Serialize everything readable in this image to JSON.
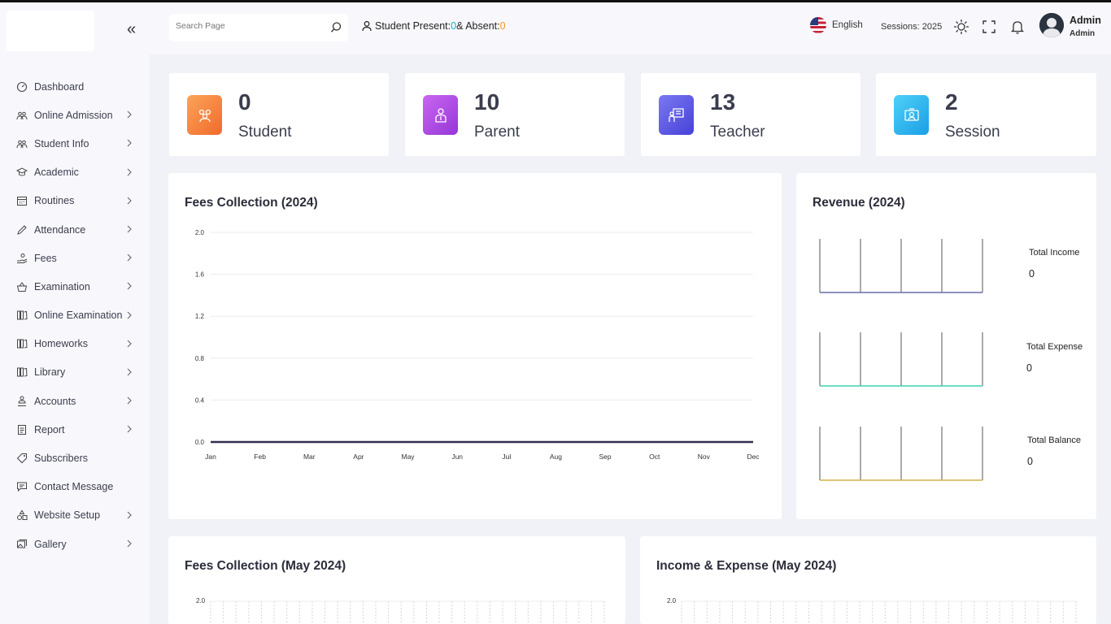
{
  "sidebar": {
    "items": [
      {
        "label": "Dashboard",
        "icon": "dashboard-icon",
        "chevron": false
      },
      {
        "label": "Online Admission",
        "icon": "users-icon",
        "chevron": true
      },
      {
        "label": "Student Info",
        "icon": "users-icon",
        "chevron": true
      },
      {
        "label": "Academic",
        "icon": "graduation-cap-icon",
        "chevron": true
      },
      {
        "label": "Routines",
        "icon": "calendar-icon",
        "chevron": true
      },
      {
        "label": "Attendance",
        "icon": "pen-icon",
        "chevron": true
      },
      {
        "label": "Fees",
        "icon": "hand-coin-icon",
        "chevron": true
      },
      {
        "label": "Examination",
        "icon": "basket-icon",
        "chevron": true
      },
      {
        "label": "Online Examination",
        "icon": "books-icon",
        "chevron": true
      },
      {
        "label": "Homeworks",
        "icon": "books-icon",
        "chevron": true
      },
      {
        "label": "Library",
        "icon": "books-icon",
        "chevron": true
      },
      {
        "label": "Accounts",
        "icon": "person-stack-icon",
        "chevron": true
      },
      {
        "label": "Report",
        "icon": "document-icon",
        "chevron": true
      },
      {
        "label": "Subscribers",
        "icon": "tag-icon",
        "chevron": false
      },
      {
        "label": "Contact Message",
        "icon": "message-icon",
        "chevron": false
      },
      {
        "label": "Website Setup",
        "icon": "shapes-icon",
        "chevron": true
      },
      {
        "label": "Gallery",
        "icon": "gallery-icon",
        "chevron": true
      }
    ]
  },
  "header": {
    "search_placeholder": "Search Page",
    "present_prefix": "Student Present: ",
    "present_count": "0",
    "present_mid": " & Absent: ",
    "absent_count": "0",
    "language": "English",
    "sessions": "Sessions: 2025",
    "user_name": "Admin",
    "user_role": "Admin"
  },
  "stats": [
    {
      "value": "0",
      "label": "Student",
      "color": "#f7853f",
      "icon": "student-group-icon"
    },
    {
      "value": "10",
      "label": "Parent",
      "color": "#b546e6",
      "icon": "parent-icon"
    },
    {
      "value": "13",
      "label": "Teacher",
      "color": "#5b58e6",
      "icon": "teacher-icon"
    },
    {
      "value": "2",
      "label": "Session",
      "color": "#27b6f0",
      "icon": "session-icon"
    }
  ],
  "fees_chart": {
    "title": "Fees Collection (2024)"
  },
  "revenue": {
    "title": "Revenue (2024)",
    "income_label": "Total Income",
    "income_value": "0",
    "expense_label": "Total Expense",
    "expense_value": "0",
    "balance_label": "Total Balance",
    "balance_value": "0",
    "colors": {
      "income": "#6a6fa8",
      "expense": "#3fd2b0",
      "balance": "#d2b24a"
    }
  },
  "fees_month": {
    "title": "Fees Collection (May 2024)",
    "top_tick": "2.0"
  },
  "income_expense": {
    "title": "Income & Expense (May 2024)",
    "top_tick": "2.0"
  },
  "chart_data": [
    {
      "type": "line",
      "title": "Fees Collection (2024)",
      "categories": [
        "Jan",
        "Feb",
        "Mar",
        "Apr",
        "May",
        "Jun",
        "Jul",
        "Aug",
        "Sep",
        "Oct",
        "Nov",
        "Dec"
      ],
      "yticks": [
        "0.0",
        "0.4",
        "0.8",
        "1.2",
        "1.6",
        "2.0"
      ],
      "ylim": [
        0,
        2
      ],
      "series": [
        {
          "values": [
            0,
            0,
            0,
            0,
            0,
            0,
            0,
            0,
            0,
            0,
            0,
            0
          ]
        }
      ],
      "grid": true,
      "line_color": "#2f2f4f"
    }
  ]
}
